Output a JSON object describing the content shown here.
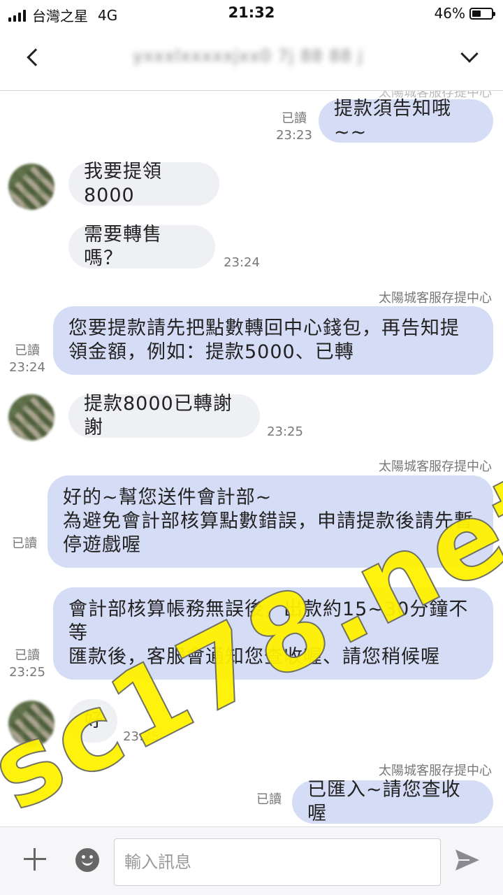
{
  "status_bar": {
    "carrier": "台灣之星",
    "network": "4G",
    "time": "21:32",
    "battery_pct": "46%",
    "battery_level": 0.46
  },
  "header": {
    "contact_name": "yxxxlxxxxxjxx0 7j 88 88 j",
    "back_icon": "chevron-left-icon",
    "menu_icon": "chevron-down-icon"
  },
  "messages": [
    {
      "side": "out",
      "text": "提款須告知哦~~",
      "read": "已讀",
      "time": "23:23"
    },
    {
      "side": "in",
      "text": "我要提領8000",
      "time": ""
    },
    {
      "side": "in",
      "text": "需要轉售嗎？",
      "time": "23:24"
    },
    {
      "side": "out",
      "sender": "太陽城客服存提中心",
      "lines": [
        "您要提款請先把點數轉回中心錢包，再告知提",
        "領金額，例如：提款5000、已轉"
      ],
      "read": "已讀",
      "time": "23:24"
    },
    {
      "side": "in",
      "text": "提款8000已轉謝謝",
      "time": "23:25"
    },
    {
      "side": "out",
      "sender": "太陽城客服存提中心",
      "lines": [
        "好的~幫您送件會計部~",
        "為避免會計部核算點數錯誤，申請提款後請先暫",
        "停遊戲喔"
      ],
      "read": "已讀",
      "time": ""
    },
    {
      "side": "out",
      "lines": [
        "會計部核算帳務無誤後，出款約15~30分鐘不",
        "等",
        "匯款後，客服會通知您查收喔、請您稍候喔"
      ],
      "read": "已讀",
      "time": "23:25"
    },
    {
      "side": "in",
      "text": "好",
      "time": "23:25"
    },
    {
      "side": "out",
      "sender": "太陽城客服存提中心",
      "text": "已匯入~請您查收喔",
      "read": "已讀",
      "time": ""
    }
  ],
  "watermark": "sc178.net",
  "input": {
    "placeholder": "輸入訊息"
  },
  "colors": {
    "outgoing_bubble": "#d5dcf5",
    "incoming_bubble": "#eef0f4",
    "watermark": "#fff200"
  }
}
